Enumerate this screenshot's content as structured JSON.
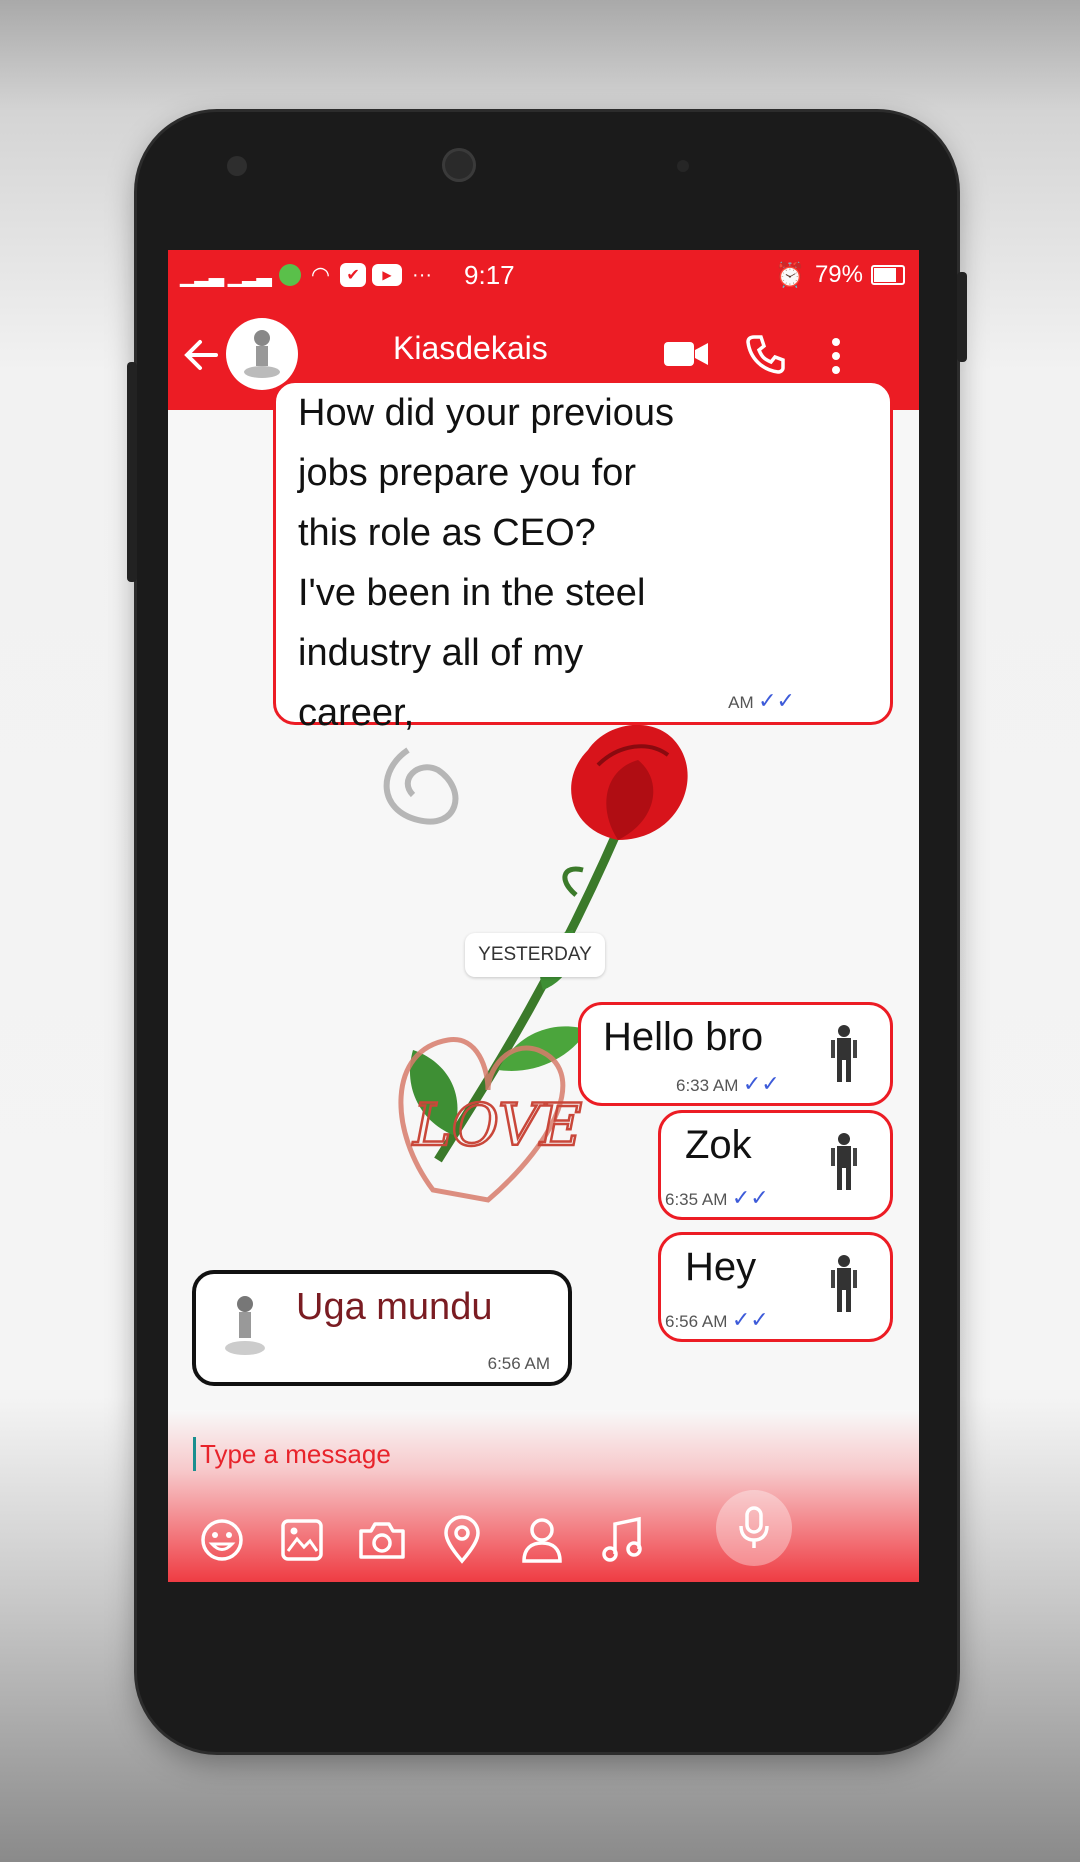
{
  "status_bar": {
    "time": "9:17",
    "battery": "79%",
    "more": "···"
  },
  "header": {
    "contact_name": "Kiasdekais"
  },
  "messages": {
    "long_in": {
      "lines": [
        "How did your previous",
        "jobs prepare you for",
        "this role as CEO?",
        "I've been in the steel",
        "industry all of my",
        "career,"
      ],
      "time": "AM"
    },
    "date_separator": "YESTERDAY",
    "outgoing": [
      {
        "text": "Hello bro",
        "time": "6:33 AM"
      },
      {
        "text": "Zok",
        "time": "6:35 AM"
      },
      {
        "text": "Hey",
        "time": "6:56 AM"
      }
    ],
    "received": {
      "text": "Uga mundu",
      "time": "6:56 AM"
    }
  },
  "background_art": {
    "love_text": "LOVE"
  },
  "composer": {
    "placeholder": "Type a message",
    "tools": [
      "emoji-icon",
      "gallery-icon",
      "camera-icon",
      "location-icon",
      "contact-icon",
      "music-icon"
    ],
    "mic_icon": "mic-icon"
  },
  "colors": {
    "accent": "#ec1c24",
    "tick_blue": "#3d5bd9",
    "received_border": "#111111"
  }
}
